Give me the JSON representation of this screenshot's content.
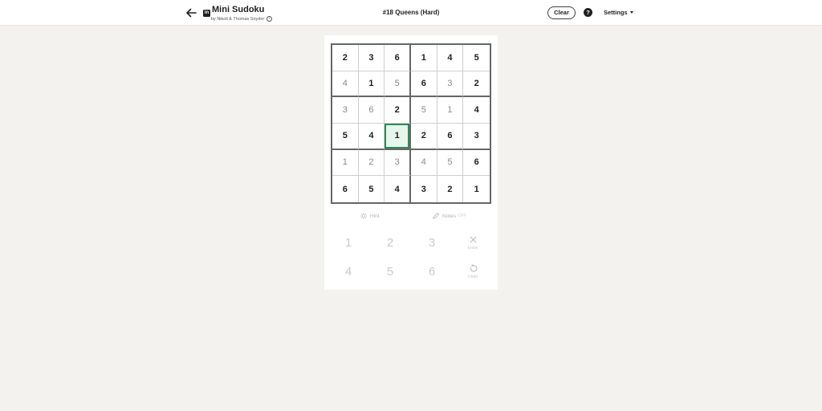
{
  "header": {
    "app_title": "Mini Sudoku",
    "byline": "by Nikoli & Thomas Snyder",
    "logo_text": "in",
    "puzzle_title": "#18 Queens (Hard)",
    "clear_label": "Clear",
    "help_label": "?",
    "settings_label": "Settings"
  },
  "board": {
    "size": 6,
    "box_rows": 2,
    "box_cols": 3,
    "selected": [
      3,
      2
    ],
    "cells": [
      [
        {
          "v": "2",
          "given": true
        },
        {
          "v": "3",
          "given": true
        },
        {
          "v": "6",
          "given": true
        },
        {
          "v": "1",
          "given": true
        },
        {
          "v": "4",
          "given": true
        },
        {
          "v": "5",
          "given": true
        }
      ],
      [
        {
          "v": "4",
          "given": false
        },
        {
          "v": "1",
          "given": true
        },
        {
          "v": "5",
          "given": false
        },
        {
          "v": "6",
          "given": true
        },
        {
          "v": "3",
          "given": false
        },
        {
          "v": "2",
          "given": true
        }
      ],
      [
        {
          "v": "3",
          "given": false
        },
        {
          "v": "6",
          "given": false
        },
        {
          "v": "2",
          "given": true
        },
        {
          "v": "5",
          "given": false
        },
        {
          "v": "1",
          "given": false
        },
        {
          "v": "4",
          "given": true
        }
      ],
      [
        {
          "v": "5",
          "given": true
        },
        {
          "v": "4",
          "given": true
        },
        {
          "v": "1",
          "given": true
        },
        {
          "v": "2",
          "given": true
        },
        {
          "v": "6",
          "given": true
        },
        {
          "v": "3",
          "given": true
        }
      ],
      [
        {
          "v": "1",
          "given": false
        },
        {
          "v": "2",
          "given": false
        },
        {
          "v": "3",
          "given": false
        },
        {
          "v": "4",
          "given": false
        },
        {
          "v": "5",
          "given": false
        },
        {
          "v": "6",
          "given": true
        }
      ],
      [
        {
          "v": "6",
          "given": true
        },
        {
          "v": "5",
          "given": true
        },
        {
          "v": "4",
          "given": true
        },
        {
          "v": "3",
          "given": true
        },
        {
          "v": "2",
          "given": true
        },
        {
          "v": "1",
          "given": true
        }
      ]
    ]
  },
  "tools": {
    "hint_label": "Hint",
    "notes_label": "Notes",
    "notes_state": "OFF"
  },
  "keypad": {
    "keys": [
      "1",
      "2",
      "3",
      "4",
      "5",
      "6"
    ],
    "erase_label": "Erase",
    "undo_label": "Undo"
  },
  "colors": {
    "accent": "#2e8a59",
    "selected_bg": "#e5f6ec",
    "page_bg": "#f3f2ef"
  }
}
